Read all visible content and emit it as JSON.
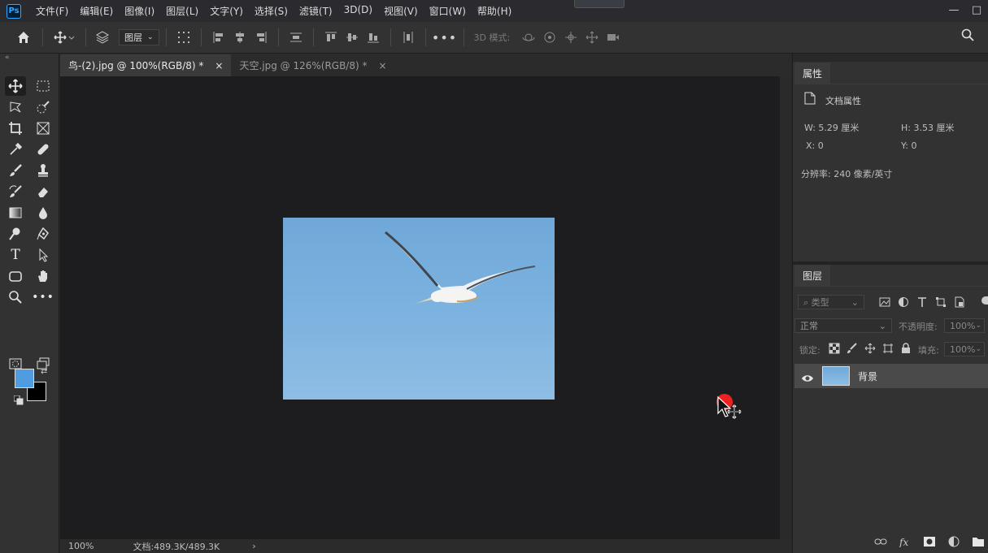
{
  "app": {
    "logo": "Ps"
  },
  "menu": [
    "文件(F)",
    "编辑(E)",
    "图像(I)",
    "图层(L)",
    "文字(Y)",
    "选择(S)",
    "滤镜(T)",
    "3D(D)",
    "视图(V)",
    "窗口(W)",
    "帮助(H)"
  ],
  "options": {
    "layer_select": "图层",
    "mode3d_label": "3D 模式:"
  },
  "tabs": [
    {
      "label": "鸟-(2).jpg @ 100%(RGB/8) *",
      "close": "×"
    },
    {
      "label": "天空.jpg @ 126%(RGB/8) *",
      "close": "×"
    }
  ],
  "status": {
    "zoom": "100%",
    "doc": "文档:489.3K/489.3K",
    "arrow": "›"
  },
  "properties": {
    "tab": "属性",
    "doc_props": "文档属性",
    "w": "W:  5.29 厘米",
    "h": "H:  3.53 厘米",
    "x": "X:  0",
    "y": "Y:  0",
    "resolution": "分辨率: 240 像素/英寸"
  },
  "layers": {
    "tab": "图层",
    "filter_kind": "类型",
    "blend_mode": "正常",
    "opacity_label": "不透明度:",
    "opacity_value": "100%",
    "lock_label": "锁定:",
    "fill_label": "填充:",
    "fill_value": "100%",
    "layer_name": "背景"
  },
  "colors": {
    "foreground": "#4f9ce0",
    "background": "#000000",
    "accent": "#31a8ff",
    "cursor_dot": "#ee2020"
  }
}
